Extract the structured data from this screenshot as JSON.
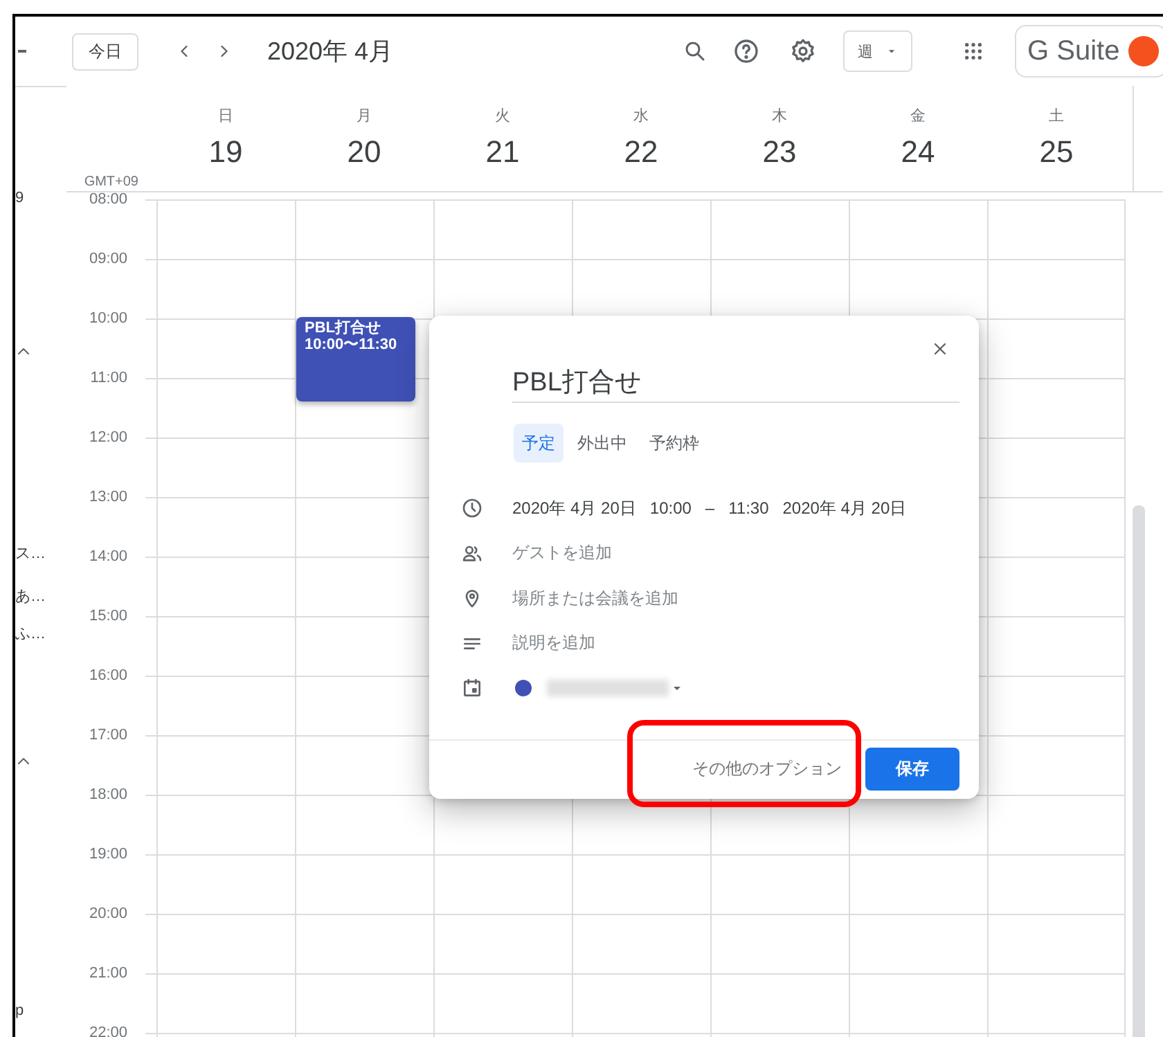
{
  "header": {
    "today_button": "今日",
    "title": "2020年 4月",
    "view_select": "週",
    "brand": "G Suite"
  },
  "sidebar_fragments": [
    {
      "kind": "text",
      "text": "9"
    },
    {
      "kind": "chevron"
    },
    {
      "kind": "text",
      "text": "ス…"
    },
    {
      "kind": "text",
      "text": "あ…"
    },
    {
      "kind": "text",
      "text": "ふ…"
    },
    {
      "kind": "chevron"
    },
    {
      "kind": "text",
      "text": "p"
    }
  ],
  "timezone": "GMT+09",
  "days": [
    {
      "weekday": "日",
      "date": "19"
    },
    {
      "weekday": "月",
      "date": "20"
    },
    {
      "weekday": "火",
      "date": "21"
    },
    {
      "weekday": "水",
      "date": "22"
    },
    {
      "weekday": "木",
      "date": "23"
    },
    {
      "weekday": "金",
      "date": "24"
    },
    {
      "weekday": "土",
      "date": "25"
    }
  ],
  "hours": [
    "08:00",
    "09:00",
    "10:00",
    "11:00",
    "12:00",
    "13:00",
    "14:00",
    "15:00",
    "16:00",
    "17:00",
    "18:00",
    "19:00",
    "20:00",
    "21:00",
    "22:00"
  ],
  "event": {
    "title": "PBL打合せ",
    "time": "10:00〜11:30"
  },
  "event_dialog": {
    "title": "PBL打合せ",
    "tabs": [
      {
        "label": "予定",
        "selected": true
      },
      {
        "label": "外出中",
        "selected": false
      },
      {
        "label": "予約枠",
        "selected": false
      }
    ],
    "rows": [
      {
        "kind": "time",
        "start_date": "2020年 4月 20日",
        "start_time": "10:00",
        "separator": "–",
        "end_time": "11:30",
        "end_date": "2020年 4月 20日"
      },
      {
        "kind": "guests",
        "placeholder": "ゲストを追加"
      },
      {
        "kind": "location",
        "placeholder": "場所または会議を追加"
      },
      {
        "kind": "description",
        "placeholder": "説明を追加"
      },
      {
        "kind": "calendar"
      }
    ],
    "more_options": "その他のオプション",
    "save": "保存"
  }
}
